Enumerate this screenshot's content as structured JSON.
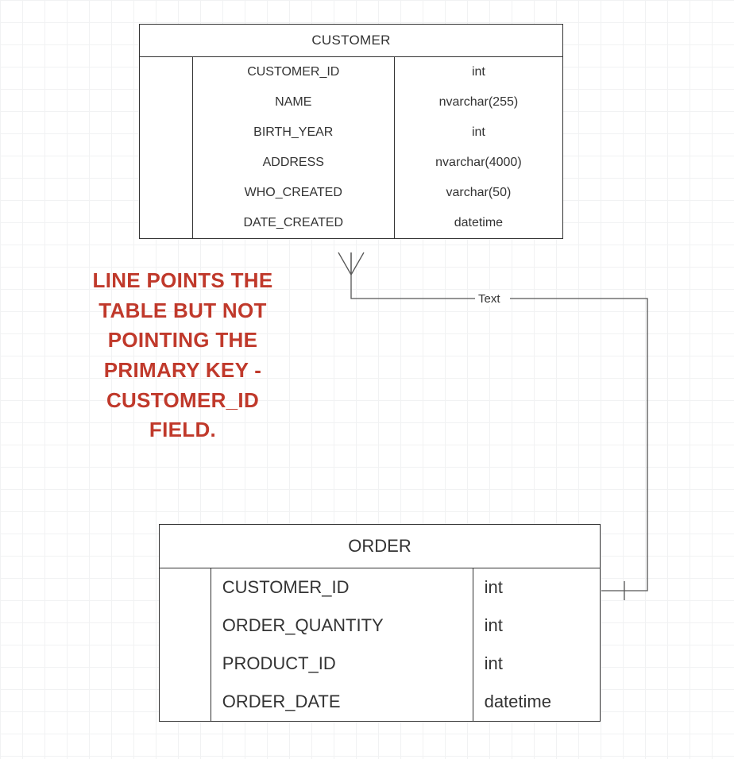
{
  "entities": {
    "customer": {
      "title": "CUSTOMER",
      "fields": [
        {
          "name": "CUSTOMER_ID",
          "type": "int"
        },
        {
          "name": "NAME",
          "type": "nvarchar(255)"
        },
        {
          "name": "BIRTH_YEAR",
          "type": "int"
        },
        {
          "name": "ADDRESS",
          "type": "nvarchar(4000)"
        },
        {
          "name": "WHO_CREATED",
          "type": "varchar(50)"
        },
        {
          "name": "DATE_CREATED",
          "type": "datetime"
        }
      ]
    },
    "order": {
      "title": "ORDER",
      "fields": [
        {
          "name": "CUSTOMER_ID",
          "type": "int"
        },
        {
          "name": "ORDER_QUANTITY",
          "type": "int"
        },
        {
          "name": "PRODUCT_ID",
          "type": "int"
        },
        {
          "name": "ORDER_DATE",
          "type": "datetime"
        }
      ]
    }
  },
  "annotation": {
    "l1": "LINE POINTS THE",
    "l2": "TABLE BUT NOT",
    "l3": "POINTING THE",
    "l4": "PRIMARY KEY -",
    "l5": "CUSTOMER_ID",
    "l6": "FIELD."
  },
  "connector": {
    "label": "Text"
  },
  "colors": {
    "annotation": "#c0392b",
    "border": "#333333"
  }
}
